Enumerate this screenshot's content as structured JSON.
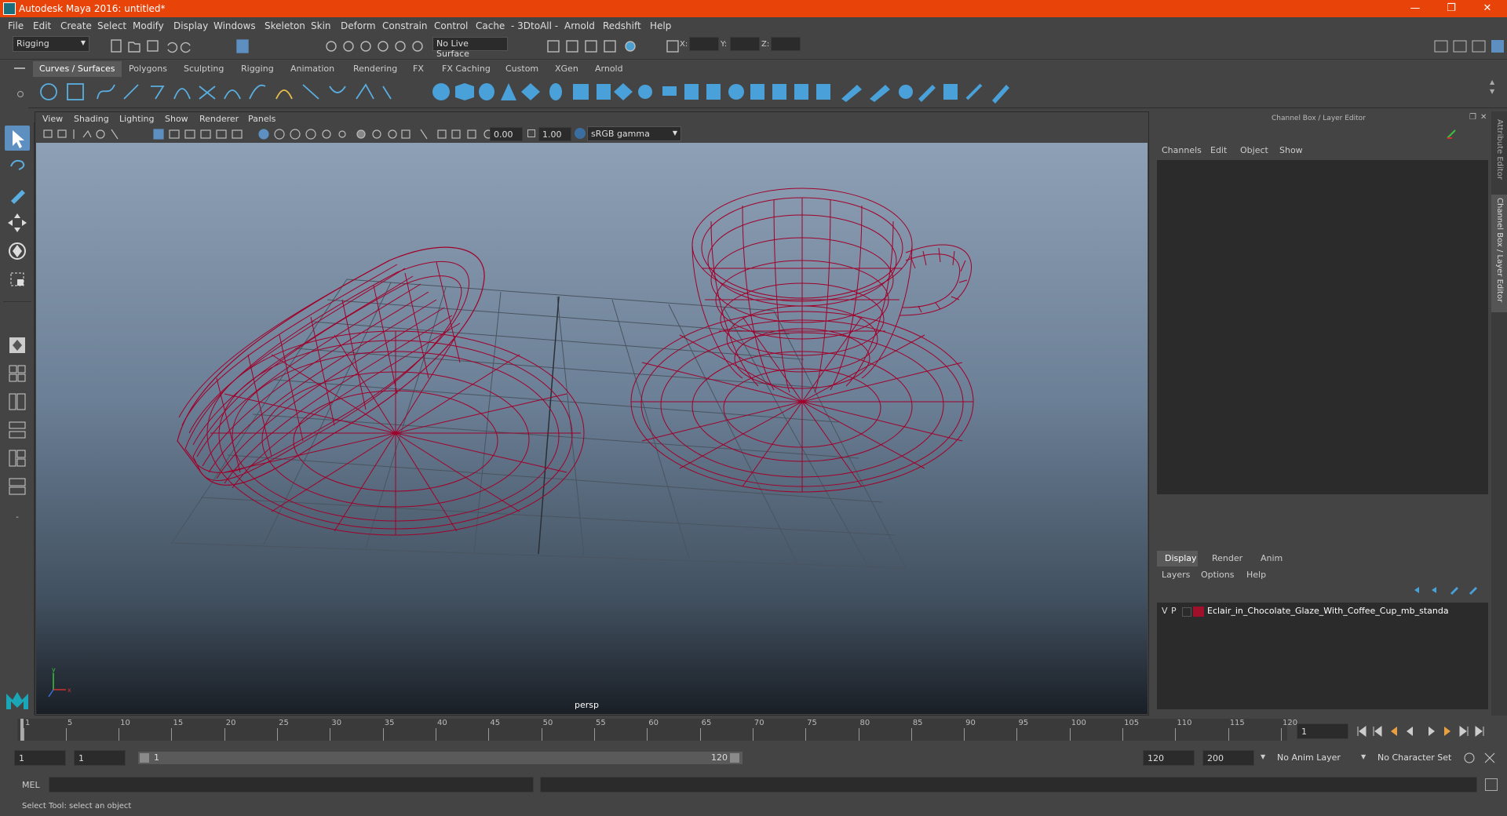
{
  "titlebar": {
    "title": "Autodesk Maya 2016: untitled*",
    "minimize": "—",
    "restore": "❐",
    "close": "✕"
  },
  "menubar": [
    "File",
    "Edit",
    "Create",
    "Select",
    "Modify",
    "Display",
    "Windows",
    "Skeleton",
    "Skin",
    "Deform",
    "Constrain",
    "Control",
    "Cache",
    "- 3DtoAll -",
    "Arnold",
    "Redshift",
    "Help"
  ],
  "statusline": {
    "mode": "Rigging",
    "live_surface": "No Live Surface",
    "x_label": "X:",
    "y_label": "Y:",
    "z_label": "Z:"
  },
  "shelf_tabs": [
    "Curves / Surfaces",
    "Polygons",
    "Sculpting",
    "Rigging",
    "Animation",
    "Rendering",
    "FX",
    "FX Caching",
    "Custom",
    "XGen",
    "Arnold"
  ],
  "shelf_active": "Curves / Surfaces",
  "viewport": {
    "menu": [
      "View",
      "Shading",
      "Lighting",
      "Show",
      "Renderer",
      "Panels"
    ],
    "exposure": "0.00",
    "gamma": "1.00",
    "colorspace": "sRGB gamma",
    "camera": "persp",
    "wire_color": "#a0002a"
  },
  "channelbox": {
    "title": "Channel Box / Layer Editor",
    "menu": [
      "Channels",
      "Edit",
      "Object",
      "Show"
    ],
    "layer_tabs": [
      "Display",
      "Render",
      "Anim"
    ],
    "layer_menu": [
      "Layers",
      "Options",
      "Help"
    ],
    "layer": {
      "v": "V",
      "p": "P",
      "name": "Eclair_in_Chocolate_Glaze_With_Coffee_Cup_mb_standa",
      "color": "#a0102a"
    }
  },
  "side_tabs": {
    "attribute_editor": "Attribute Editor",
    "channel_box": "Channel Box / Layer Editor"
  },
  "timeline": {
    "ticks": [
      "1",
      "5",
      "10",
      "15",
      "20",
      "25",
      "30",
      "35",
      "40",
      "45",
      "50",
      "55",
      "60",
      "65",
      "70",
      "75",
      "80",
      "85",
      "90",
      "95",
      "100",
      "105",
      "110",
      "115",
      "120"
    ],
    "current_frame": "1"
  },
  "range": {
    "start": "1",
    "inner_start": "1",
    "slider_start": "1",
    "slider_end": "120",
    "end": "120",
    "outer_end": "200",
    "anim_layer": "No Anim Layer",
    "char_set": "No Character Set"
  },
  "cmdline": {
    "label": "MEL"
  },
  "helpline": {
    "text": "Select Tool: select an object"
  }
}
